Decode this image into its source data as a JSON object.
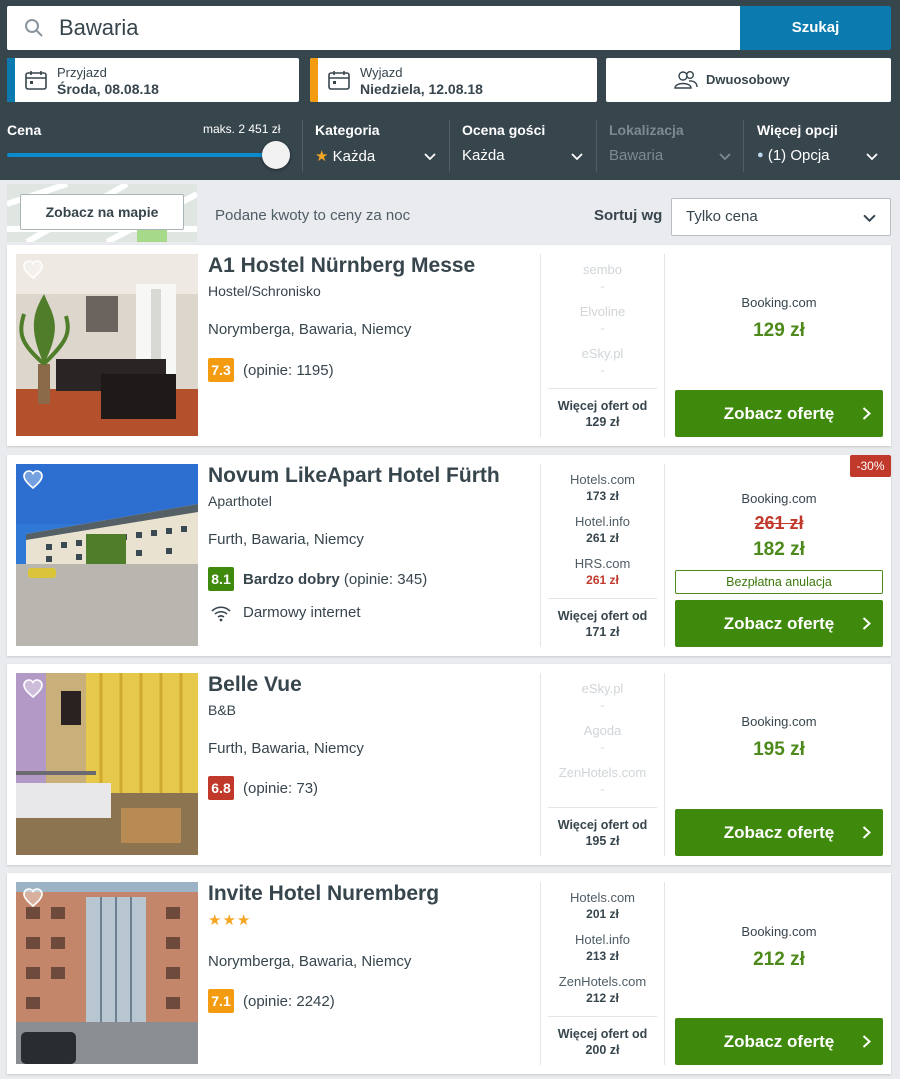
{
  "search": {
    "query": "Bawaria",
    "button": "Szukaj"
  },
  "checkin": {
    "label": "Przyjazd",
    "date": "Środa, 08.08.18",
    "accent": "#0a7aaf"
  },
  "checkout": {
    "label": "Wyjazd",
    "date": "Niedziela, 12.08.18",
    "accent": "#f39c12"
  },
  "room": {
    "label": "Dwuosobowy"
  },
  "filters": {
    "price": {
      "label": "Cena",
      "max": "maks. 2 451 zł",
      "fill": 1.0
    },
    "category": {
      "label": "Kategoria",
      "value": "Każda"
    },
    "rating": {
      "label": "Ocena gości",
      "value": "Każda"
    },
    "location": {
      "label": "Lokalizacja",
      "value": "Bawaria"
    },
    "more": {
      "label": "Więcej opcji",
      "value": "(1) Opcja"
    }
  },
  "toolbar": {
    "map_button": "Zobacz na mapie",
    "note": "Podane kwoty to ceny za noc",
    "sort_label": "Sortuj wg",
    "sort_value": "Tylko cena"
  },
  "hotels": [
    {
      "name": "A1 Hostel Nürnberg Messe",
      "type": "Hostel/Schronisko",
      "location": "Norymberga, Bawaria, Niemcy",
      "rating": "7.3",
      "rating_color": "#f39c12",
      "reviews": "(opinie: 1195)",
      "providers": [
        {
          "name": "sembo",
          "price": "-"
        },
        {
          "name": "Elvoline",
          "price": "-"
        },
        {
          "name": "eSky.pl",
          "price": "-"
        }
      ],
      "more_label": "Więcej ofert od",
      "more_price": "129 zł",
      "site": "Booking.com",
      "price": "129 zł",
      "offer": "Zobacz ofertę"
    },
    {
      "name": "Novum LikeApart Hotel Fürth",
      "type": "Aparthotel",
      "location": "Furth, Bawaria, Niemcy",
      "rating": "8.1",
      "rating_color": "#3f8a0c",
      "rating_word": "Bardzo dobry",
      "reviews": "(opinie: 345)",
      "amenity": "Darmowy internet",
      "providers": [
        {
          "name": "Hotels.com",
          "price": "173 zł"
        },
        {
          "name": "Hotel.info",
          "price": "261 zł"
        },
        {
          "name": "HRS.com",
          "price": "261 zł"
        }
      ],
      "more_label": "Więcej ofert od",
      "more_price": "171 zł",
      "site": "Booking.com",
      "old_price": "261 zł",
      "price": "182 zł",
      "free_cancel": "Bezpłatna anulacja",
      "discount": "-30%",
      "offer": "Zobacz ofertę"
    },
    {
      "name": "Belle Vue",
      "type": "B&B",
      "location": "Furth, Bawaria, Niemcy",
      "rating": "6.8",
      "rating_color": "#c0392b",
      "reviews": "(opinie: 73)",
      "providers": [
        {
          "name": "eSky.pl",
          "price": "-"
        },
        {
          "name": "Agoda",
          "price": "-"
        },
        {
          "name": "ZenHotels.com",
          "price": "-"
        }
      ],
      "more_label": "Więcej ofert od",
      "more_price": "195 zł",
      "site": "Booking.com",
      "price": "195 zł",
      "offer": "Zobacz ofertę"
    },
    {
      "name": "Invite Hotel Nuremberg",
      "stars": "★★★",
      "location": "Norymberga, Bawaria, Niemcy",
      "rating": "7.1",
      "rating_color": "#f39c12",
      "reviews": "(opinie: 2242)",
      "providers": [
        {
          "name": "Hotels.com",
          "price": "201 zł"
        },
        {
          "name": "Hotel.info",
          "price": "213 zł"
        },
        {
          "name": "ZenHotels.com",
          "price": "212 zł"
        }
      ],
      "more_label": "Więcej ofert od",
      "more_price": "200 zł",
      "site": "Booking.com",
      "price": "212 zł",
      "offer": "Zobacz ofertę"
    }
  ]
}
